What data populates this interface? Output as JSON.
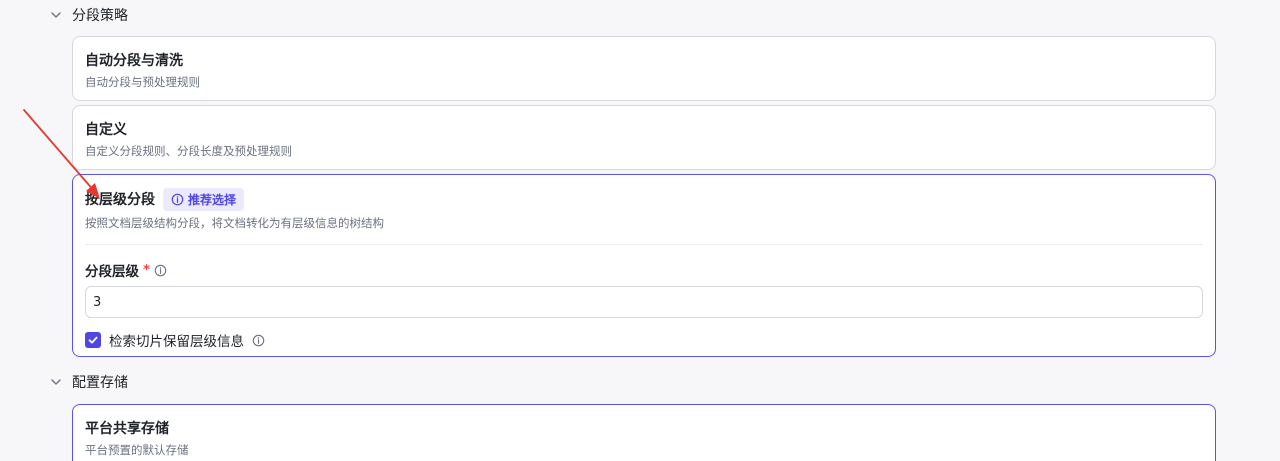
{
  "segmentation": {
    "section_title": "分段策略",
    "options": [
      {
        "title": "自动分段与清洗",
        "description": "自动分段与预处理规则"
      },
      {
        "title": "自定义",
        "description": "自定义分段规则、分段长度及预处理规则"
      },
      {
        "title": "按层级分段",
        "badge": "推荐选择",
        "description": "按照文档层级结构分段，将文档转化为有层级信息的树结构"
      }
    ],
    "level_field": {
      "label": "分段层级",
      "required_mark": "*",
      "value": "3"
    },
    "retain_checkbox": {
      "label": "检索切片保留层级信息",
      "checked": true
    }
  },
  "storage": {
    "section_title": "配置存储",
    "options": [
      {
        "title": "平台共享存储",
        "description": "平台预置的默认存储"
      }
    ]
  },
  "colors": {
    "accent": "#4f46e5",
    "selected_border": "#5b54e8",
    "annotation_arrow": "#e8372c"
  },
  "icons": {
    "section_toggle": "chevron-down-icon",
    "badge": "info-icon",
    "help": "info-icon",
    "checkbox": "check-icon"
  }
}
